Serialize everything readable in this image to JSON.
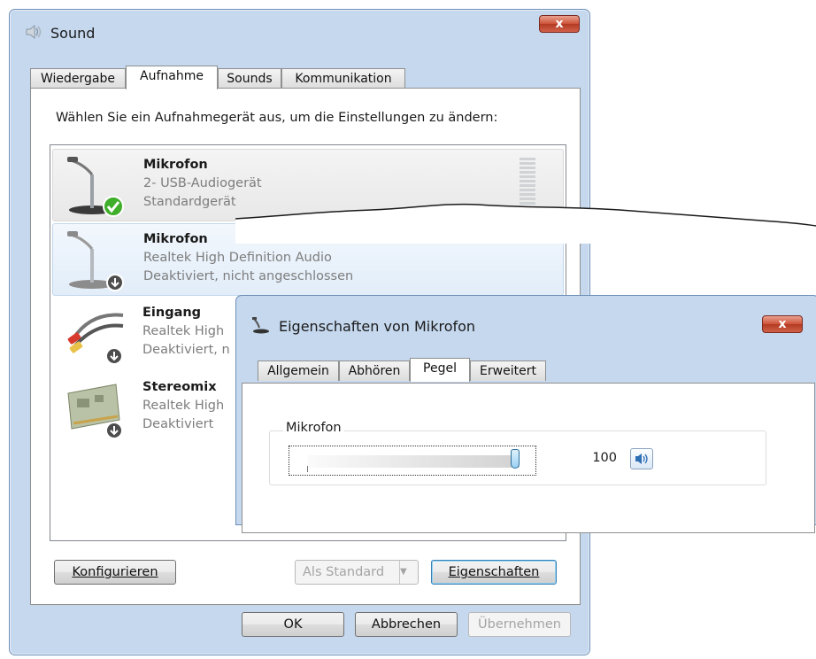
{
  "sound_window": {
    "title": "Sound",
    "close_label": "x",
    "tabs": [
      {
        "label": "Wiedergabe"
      },
      {
        "label": "Aufnahme"
      },
      {
        "label": "Sounds"
      },
      {
        "label": "Kommunikation"
      }
    ],
    "instruction": "Wählen Sie ein Aufnahmegerät aus, um die Einstellungen zu ändern:",
    "devices": [
      {
        "name": "Mikrofon",
        "driver": "2- USB-Audiogerät",
        "status": "Standardgerät",
        "icon": "microphone-icon"
      },
      {
        "name": "Mikrofon",
        "driver": "Realtek High Definition Audio",
        "status": "Deaktiviert, nicht angeschlossen",
        "icon": "microphone-icon"
      },
      {
        "name": "Eingang",
        "driver": "Realtek High",
        "status": "Deaktiviert, n",
        "icon": "audio-cable-icon"
      },
      {
        "name": "Stereomix",
        "driver": "Realtek High",
        "status": "Deaktiviert",
        "icon": "sound-card-icon"
      }
    ],
    "buttons": {
      "configure": "Konfigurieren",
      "set_default": "Als Standard",
      "properties": "Eigenschaften",
      "ok": "OK",
      "cancel": "Abbrechen",
      "apply": "Übernehmen"
    }
  },
  "properties_window": {
    "title": "Eigenschaften von Mikrofon",
    "close_label": "x",
    "tabs": [
      {
        "label": "Allgemein"
      },
      {
        "label": "Abhören"
      },
      {
        "label": "Pegel"
      },
      {
        "label": "Erweitert"
      }
    ],
    "group_label": "Mikrofon",
    "level_value": "100",
    "level_fraction": 1.0
  },
  "colors": {
    "window_frame": "#c5d8ee",
    "close_red": "#cd5237",
    "selection_blue": "#e2edf9",
    "disabled_text": "#a4a4a4"
  }
}
